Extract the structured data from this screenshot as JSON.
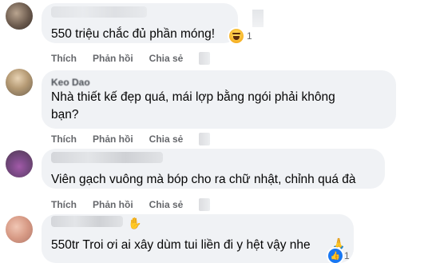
{
  "actions": {
    "like": "Thích",
    "reply": "Phản hồi",
    "share": "Chia sẻ"
  },
  "comments": [
    {
      "author": "",
      "text": "550 triệu chắc đủ phần móng!",
      "reaction_count": "1",
      "reaction_icon": "haha-emoji-icon"
    },
    {
      "author": "Keo Dao",
      "text_line1": "Nhà thiết kế đẹp quá, mái lợp bằng ngói phải không",
      "text_line2": "bạn?"
    },
    {
      "author": "",
      "text": "Viên gạch vuông mà bóp cho ra chữ nhật, chỉnh quá đà"
    },
    {
      "author": "",
      "text": "550tr Troi ơi ai xây dùm tui liền đi y hệt vậy nhe",
      "reaction_count": "1",
      "reaction_icon": "like-icon",
      "author_badge_icon": "waving-hand-icon",
      "trailing_emoji": "folded-hands-icon"
    }
  ],
  "colors": {
    "bubble": "#f0f2f5",
    "text": "#050505",
    "secondary_text": "#65676b",
    "like_blue": "#1877f2"
  }
}
